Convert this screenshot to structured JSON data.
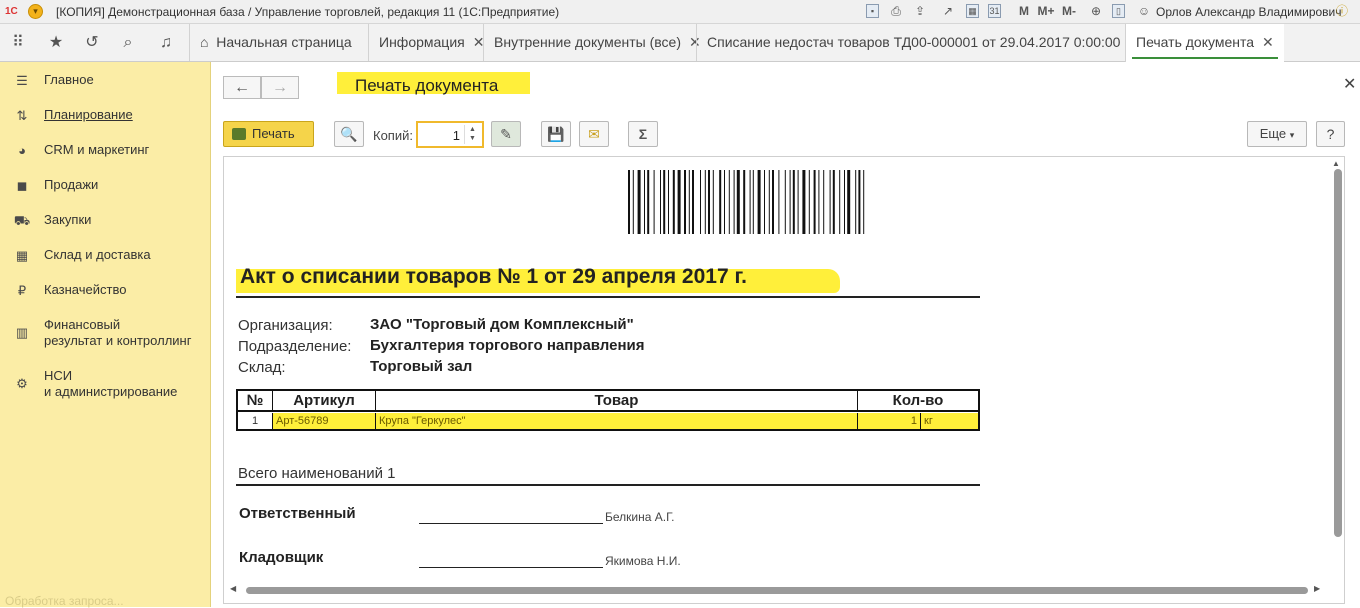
{
  "window": {
    "title": "[КОПИЯ] Демонстрационная база / Управление торговлей, редакция 11   (1С:Предприятие)",
    "user": "Орлов Александр Владимирович",
    "logo": "1С",
    "toolbar": {
      "m": "M",
      "mplus": "M+",
      "mminus": "M-"
    }
  },
  "tabs": [
    {
      "label": "Начальная страница"
    },
    {
      "label": "Информация"
    },
    {
      "label": "Внутренние документы (все)"
    },
    {
      "label": "Списание недостач товаров ТД00-000001 от 29.04.2017 0:00:00"
    },
    {
      "label": "Печать документа"
    }
  ],
  "sidebar": {
    "items": [
      {
        "label": "Главное"
      },
      {
        "label": "Планирование"
      },
      {
        "label": "CRM и маркетинг"
      },
      {
        "label": "Продажи"
      },
      {
        "label": "Закупки"
      },
      {
        "label": "Склад и доставка"
      },
      {
        "label": "Казначейство"
      },
      {
        "label": "Финансовый",
        "label2": "результат и контроллинг"
      },
      {
        "label": "НСИ",
        "label2": "и администрирование"
      }
    ],
    "status": "Обработка запроса..."
  },
  "form": {
    "title": "Печать документа",
    "print_label": "Печать",
    "copies_label": "Копий:",
    "copies_value": "1",
    "more_label": "Еще",
    "help_label": "?",
    "sigma": "Σ"
  },
  "document": {
    "heading": "Акт о списании товаров № 1 от 29 апреля 2017 г.",
    "org_label": "Организация:",
    "org_value": "ЗАО \"Торговый дом Комплексный\"",
    "dept_label": "Подразделение:",
    "dept_value": "Бухгалтерия торгового направления",
    "store_label": "Склад:",
    "store_value": "Торговый зал",
    "table": {
      "headers": [
        "№",
        "Артикул",
        "Товар",
        "Кол-во"
      ],
      "rows": [
        {
          "num": "1",
          "article": "Арт-56789",
          "product": "Крупа \"Геркулес\"",
          "qty": "1",
          "unit": "кг"
        }
      ]
    },
    "total": "Всего наименований 1",
    "responsible_label": "Ответственный",
    "responsible_name": "Белкина А.Г.",
    "keeper_label": "Кладовщик",
    "keeper_name": "Якимова Н.И."
  },
  "colors": {
    "accent_yellow": "#ffef3a",
    "sidebar_bg": "#fbeda6",
    "print_button": "#f5d44a",
    "active_tab_line": "#3a8f3a"
  }
}
